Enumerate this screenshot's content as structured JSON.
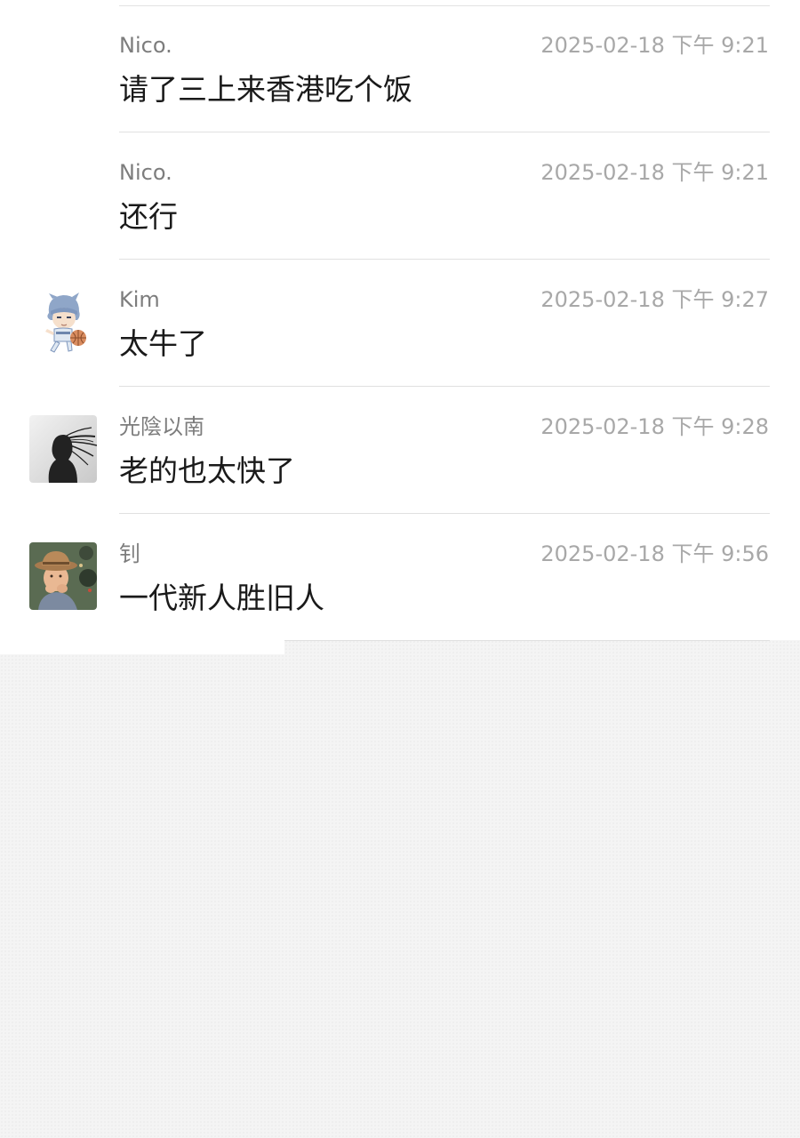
{
  "messages": [
    {
      "sender": "Nico.",
      "time": "2025-02-18 下午 9:21",
      "text": "请了三上来香港吃个饭",
      "avatar": null
    },
    {
      "sender": "Nico.",
      "time": "2025-02-18 下午 9:21",
      "text": "还行",
      "avatar": null
    },
    {
      "sender": "Kim",
      "time": "2025-02-18 下午 9:27",
      "text": "太牛了",
      "avatar": "anime-character-basketball-avatar"
    },
    {
      "sender": "光陰以南",
      "time": "2025-02-18 下午 9:28",
      "text": "老的也太快了",
      "avatar": "silhouette-windblown-hair-avatar"
    },
    {
      "sender": "钊",
      "time": "2025-02-18 下午 9:56",
      "text": "一代新人胜旧人",
      "avatar": "child-with-hat-photo-avatar"
    }
  ]
}
